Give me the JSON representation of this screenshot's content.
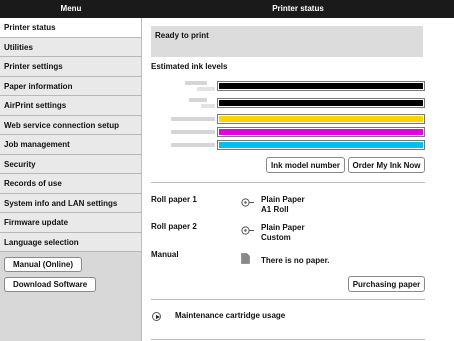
{
  "header": {
    "menu_title": "Menu",
    "page_title": "Printer status"
  },
  "sidebar": {
    "items": [
      {
        "label": "Printer status",
        "active": true
      },
      {
        "label": "Utilities"
      },
      {
        "label": "Printer settings"
      },
      {
        "label": "Paper information"
      },
      {
        "label": "AirPrint settings"
      },
      {
        "label": "Web service connection setup"
      },
      {
        "label": "Job management"
      },
      {
        "label": "Security"
      },
      {
        "label": "Records of use"
      },
      {
        "label": "System info and LAN settings"
      },
      {
        "label": "Firmware update"
      },
      {
        "label": "Language selection"
      }
    ],
    "buttons": {
      "manual": "Manual (Online)",
      "download": "Download Software"
    }
  },
  "status": {
    "text": "Ready to print"
  },
  "ink": {
    "title": "Estimated ink levels",
    "levels": [
      {
        "color": "#000000",
        "level": 1.0
      },
      {
        "color": "#000000",
        "level": 1.0
      },
      {
        "color": "#ffd400",
        "level": 1.0
      },
      {
        "color": "#e000e0",
        "level": 1.0
      },
      {
        "color": "#00c0f0",
        "level": 1.0
      }
    ],
    "buttons": {
      "model": "Ink model number",
      "order": "Order My Ink Now"
    }
  },
  "paper": {
    "roll1": {
      "label": "Roll paper 1",
      "type": "Plain Paper",
      "size": "A1 Roll",
      "icon": "roll-paper-icon"
    },
    "roll2": {
      "label": "Roll paper 2",
      "type": "Plain Paper",
      "size": "Custom",
      "icon": "roll-paper-icon"
    },
    "manual": {
      "label": "Manual",
      "value": "There is no paper.",
      "icon": "sheet-paper-icon"
    },
    "purchase": "Purchasing paper"
  },
  "maintenance": {
    "label": "Maintenance cartridge usage",
    "icon": "expand-play-icon"
  }
}
